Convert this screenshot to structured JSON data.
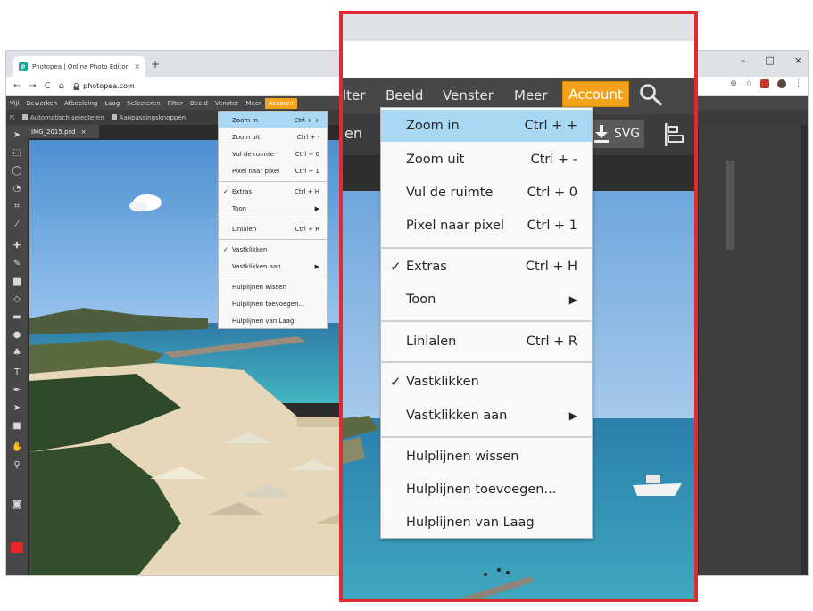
{
  "browser": {
    "tab_title": "Photopea | Online Photo Editor",
    "tab_close": "×",
    "new_tab": "+",
    "url": "photopea.com",
    "window_controls": [
      "–",
      "□",
      "×"
    ],
    "nav_icons": [
      "←",
      "→",
      "C",
      "⌂"
    ]
  },
  "app": {
    "menu": [
      "Vijl",
      "Bewerken",
      "Afbeelding",
      "Laag",
      "Selecteren",
      "Filter",
      "Beeld",
      "Venster",
      "Meer"
    ],
    "account_label": "Account",
    "options": {
      "auto_select": "Automatisch selecteren",
      "adjust_handles": "Aanpassingsknoppen"
    },
    "document_tab": "IMG_2015.psd",
    "document_close": "×",
    "accent_color": "#f3a21b",
    "foreground_color": "#e8262a"
  },
  "zoom": {
    "menubar_fragment": "lter",
    "menu": [
      "Beeld",
      "Venster",
      "Meer"
    ],
    "account_label": "Account",
    "options_fragment": "en",
    "svg_label": "SVG",
    "highlight_color": "#a9d8f5",
    "frame_color": "#e02b33"
  },
  "beeld_menu": {
    "items": [
      {
        "label": "Zoom in",
        "shortcut": "Ctrl + +",
        "highlighted": true
      },
      {
        "label": "Zoom uit",
        "shortcut": "Ctrl + -"
      },
      {
        "label": "Vul de ruimte",
        "shortcut": "Ctrl + 0"
      },
      {
        "label": "Pixel naar pixel",
        "shortcut": "Ctrl + 1"
      },
      {
        "label": "Extras",
        "shortcut": "Ctrl + H",
        "checked": true,
        "check_mark": "✓"
      },
      {
        "label": "Toon",
        "submenu": true,
        "arrow": "▶"
      },
      {
        "label": "Linialen",
        "shortcut": "Ctrl + R"
      },
      {
        "label": "Vastklikken",
        "checked": true,
        "check_mark": "✓"
      },
      {
        "label": "Vastklikken aan",
        "submenu": true,
        "arrow": "▶"
      },
      {
        "label": "Hulplijnen wissen"
      },
      {
        "label": "Hulplijnen toevoegen..."
      },
      {
        "label": "Hulplijnen van Laag"
      }
    ]
  },
  "icons": {
    "tools": [
      "move-tool-icon",
      "marquee-icon",
      "lasso-icon",
      "quick-select-icon",
      "crop-icon",
      "eyedropper-icon",
      "healing-icon",
      "brush-icon",
      "stamp-icon",
      "eraser-icon",
      "gradient-icon",
      "blur-icon",
      "dodge-icon",
      "type-icon",
      "pen-icon",
      "path-select-icon",
      "shape-icon",
      "hand-icon",
      "zoom-icon"
    ]
  }
}
